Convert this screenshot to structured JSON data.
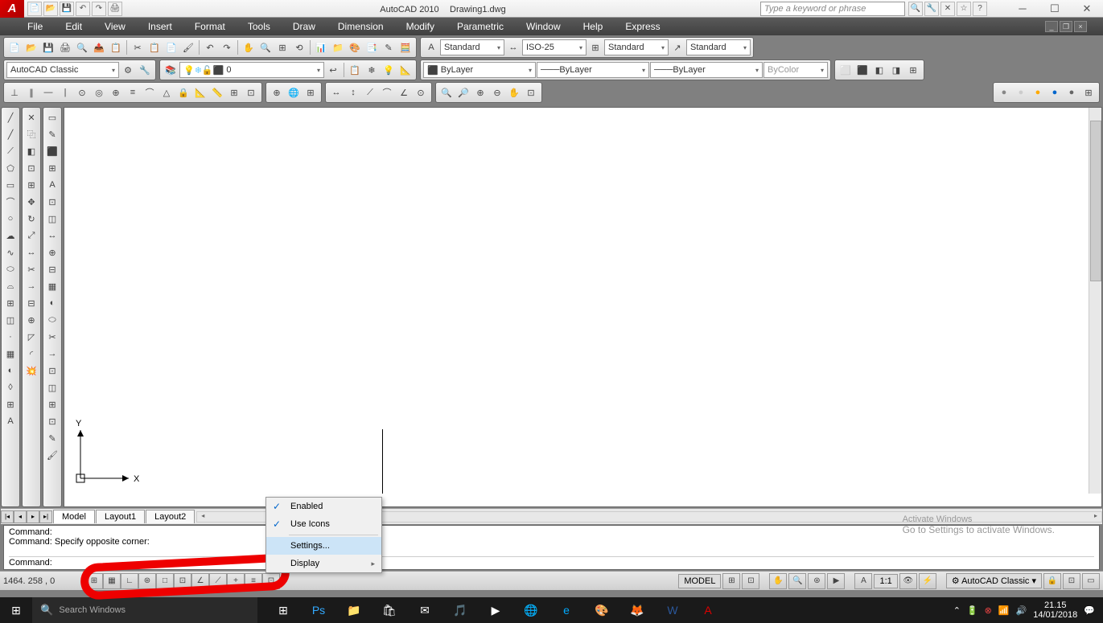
{
  "title": {
    "app": "AutoCAD 2010",
    "file": "Drawing1.dwg"
  },
  "search_placeholder": "Type a keyword or phrase",
  "menus": [
    "File",
    "Edit",
    "View",
    "Insert",
    "Format",
    "Tools",
    "Draw",
    "Dimension",
    "Modify",
    "Parametric",
    "Window",
    "Help",
    "Express"
  ],
  "workspace": "AutoCAD Classic",
  "layer": "0",
  "styles": {
    "text": "Standard",
    "dim": "ISO-25",
    "table": "Standard",
    "mleader": "Standard"
  },
  "props": {
    "color": "ByLayer",
    "ltype": "ByLayer",
    "lweight": "ByLayer",
    "plotstyle": "ByColor"
  },
  "tabs": [
    "Model",
    "Layout1",
    "Layout2"
  ],
  "cmd_history": [
    "Command:",
    "Command: Specify opposite corner:"
  ],
  "cmd_prompt": "Command:",
  "coords": "1464. 258 , 0",
  "context_menu": [
    {
      "label": "Enabled",
      "checked": true
    },
    {
      "label": "Use Icons",
      "checked": true
    },
    {
      "label": "Settings...",
      "highlighted": true
    },
    {
      "label": "Display",
      "submenu": true
    }
  ],
  "status": {
    "space": "MODEL",
    "scale": "1:1",
    "ws": "AutoCAD Classic"
  },
  "watermark": {
    "title": "Activate Windows",
    "sub": "Go to Settings to activate Windows."
  },
  "taskbar": {
    "search": "Search Windows",
    "time": "21.15",
    "date": "14/01/2018"
  },
  "ucs": {
    "x": "X",
    "y": "Y"
  }
}
